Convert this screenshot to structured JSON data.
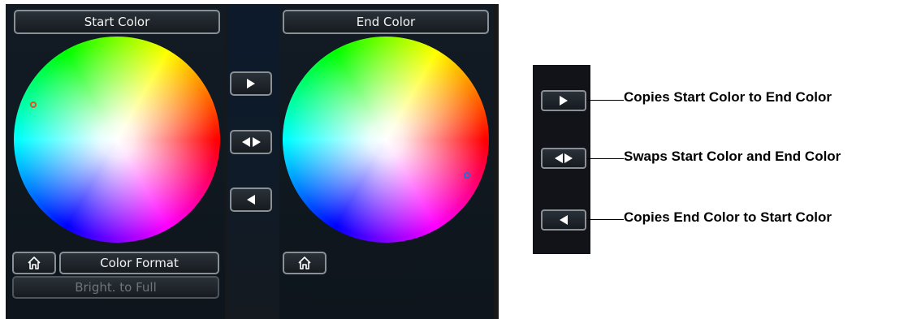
{
  "start_panel": {
    "title": "Start Color",
    "marker_color": "#e0521f",
    "home_icon": "home-icon",
    "format_label": "Color Format",
    "bright_label": "Bright. to Full"
  },
  "end_panel": {
    "title": "End Color",
    "marker_color": "#1f6fd6",
    "home_icon": "home-icon"
  },
  "transfer_buttons": {
    "copy_start_to_end_icon": "arrow-right-icon",
    "swap_icon": "swap-arrows-icon",
    "copy_end_to_start_icon": "arrow-left-icon"
  },
  "legend": {
    "copy_start_to_end": "Copies Start Color to End Color",
    "swap": "Swaps Start Color and End Color",
    "copy_end_to_start": "Copies End Color to Start Color"
  },
  "colors": {
    "panel_bg": "#181818",
    "button_border": "#8a9096",
    "button_text": "#f2f2f2",
    "disabled_text": "#6e747a"
  }
}
